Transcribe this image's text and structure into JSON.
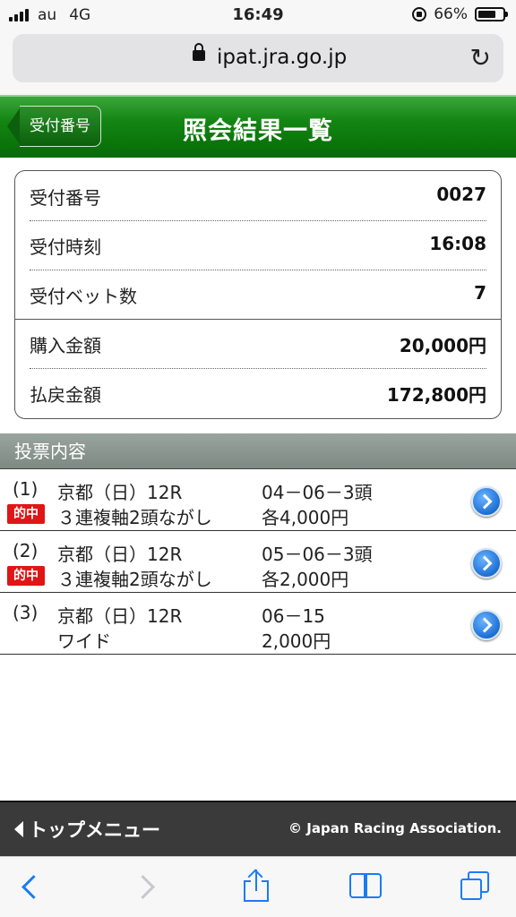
{
  "status_bar": {
    "carrier": "au",
    "network": "4G",
    "time": "16:49",
    "battery": "66%"
  },
  "browser": {
    "url": "ipat.jra.go.jp"
  },
  "header": {
    "back_label": "受付番号",
    "title": "照会結果一覧"
  },
  "summary": {
    "rows": [
      {
        "label": "受付番号",
        "value": "0027"
      },
      {
        "label": "受付時刻",
        "value": "16:08"
      },
      {
        "label": "受付ベット数",
        "value": "7"
      },
      {
        "label": "購入金額",
        "value": "20,000円"
      },
      {
        "label": "払戻金額",
        "value": "172,800円"
      }
    ]
  },
  "section_title": "投票内容",
  "bets": [
    {
      "num": "(1)",
      "race": "京都（日）12R",
      "combo": "04－06－3頭",
      "type": "３連複軸2頭ながし",
      "amount": "各4,000円",
      "hit": "的中"
    },
    {
      "num": "(2)",
      "race": "京都（日）12R",
      "combo": "05－06－3頭",
      "type": "３連複軸2頭ながし",
      "amount": "各2,000円",
      "hit": "的中"
    },
    {
      "num": "(3)",
      "race": "京都（日）12R",
      "combo": "06－15",
      "type": "ワイド",
      "amount": "2,000円",
      "hit": ""
    }
  ],
  "footer": {
    "menu_label": "トップメニュー",
    "copyright": "© Japan Racing Association."
  },
  "icons": {
    "reload": "reload-icon",
    "lock": "lock-icon",
    "go": "chevron-right-circle-icon"
  },
  "colors": {
    "header_green": "#138513",
    "hit_red": "#e01515",
    "link_blue": "#1a7cf5"
  }
}
